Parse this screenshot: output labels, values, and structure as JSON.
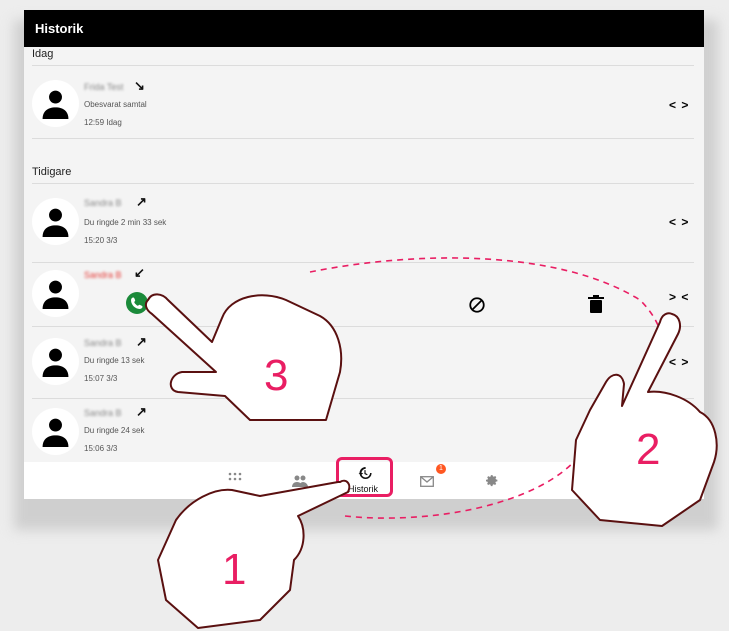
{
  "header": {
    "title": "Historik"
  },
  "sections": {
    "today": "Idag",
    "earlier": "Tidigare"
  },
  "calls": [
    {
      "name": "Frida Test",
      "direction": "↘",
      "detail": "Obesvarat samtal",
      "time": "12:59 Idag"
    },
    {
      "name": "Sandra B",
      "direction": "↗",
      "detail": "Du ringde 2 min 33 sek",
      "time": "15:20 3/3"
    },
    {
      "name": "Sandra B",
      "direction": "↙"
    },
    {
      "name": "Sandra B",
      "direction": "↗",
      "detail": "Du ringde 13 sek",
      "time": "15:07 3/3"
    },
    {
      "name": "Sandra B",
      "direction": "↗",
      "detail": "Du ringde 24 sek",
      "time": "15:06 3/3"
    }
  ],
  "row_chevron": "< >",
  "open_chevron": "> <",
  "nav": {
    "history_label": "Historik",
    "messages_badge": "1"
  },
  "steps": [
    "1",
    "2",
    "3"
  ],
  "colors": {
    "accent": "#e91e63",
    "call": "#1b8a3a",
    "missed": "#e53935"
  },
  "icons": [
    "keypad-icon",
    "contacts-icon",
    "history-icon",
    "mail-icon",
    "gear-icon",
    "phone-icon",
    "block-icon",
    "trash-icon",
    "person-icon",
    "hand-pointer-icon"
  ]
}
